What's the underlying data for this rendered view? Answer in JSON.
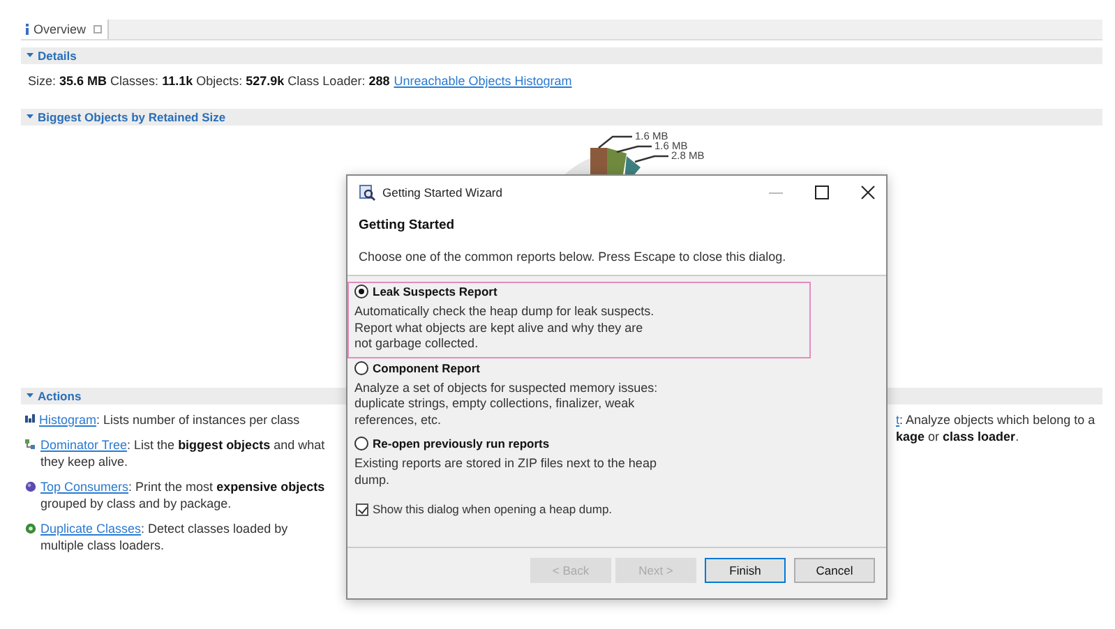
{
  "tab": {
    "label": "Overview",
    "selected": true
  },
  "details": {
    "title": "Details",
    "expanded": true,
    "stats": [
      {
        "label": "Size:",
        "value": "35.6 MB"
      },
      {
        "label": "Classes:",
        "value": "11.1k"
      },
      {
        "label": "Objects:",
        "value": "527.9k"
      },
      {
        "label": "Class Loader:",
        "value": "288"
      }
    ],
    "link": "Unreachable Objects Histogram"
  },
  "biggest": {
    "title": "Biggest Objects by Retained Size",
    "expanded": true,
    "pie_labels": [
      "1.6 MB",
      "1.6 MB",
      "2.8 MB"
    ]
  },
  "actions": {
    "title": "Actions",
    "expanded": true,
    "items": [
      {
        "kind": "histogram",
        "link": "Histogram",
        "text": ": Lists number of instances per class"
      },
      {
        "kind": "tree",
        "link": "Dominator Tree",
        "text": ": List the **biggest objects** and what they keep alive."
      },
      {
        "kind": "sphere",
        "link": "Top Consumers",
        "text": ": Print the most **expensive objects** grouped by class and by package."
      },
      {
        "kind": "duplicate",
        "link": "Duplicate Classes",
        "text": ": Detect classes loaded by multiple class loaders."
      }
    ],
    "right_item": {
      "link": "t",
      "text": ": Analyze objects which belong to a",
      "text_2": "**kage** or **class loader**."
    }
  },
  "dialog": {
    "title": "Getting Started Wizard",
    "heading": "Getting Started",
    "description": "Choose one of the common reports below. Press Escape to close this dialog.",
    "options": [
      {
        "label": "Leak Suspects Report",
        "selected": true,
        "highlighted": true,
        "description": "Automatically check the heap dump for leak suspects. Report what objects are kept alive and why they are not garbage collected."
      },
      {
        "label": "Component Report",
        "selected": false,
        "highlighted": false,
        "description": "Analyze a set of objects for suspected memory issues: duplicate strings, empty collections, finalizer, weak references, etc."
      },
      {
        "label": "Re-open previously run reports",
        "selected": false,
        "highlighted": false,
        "description": "Existing reports are stored in ZIP files next to the heap dump."
      }
    ],
    "show_dialog": {
      "label": "Show this dialog when opening a heap dump.",
      "checked": true
    },
    "buttons": [
      {
        "label": "< Back",
        "disabled": true,
        "default": false
      },
      {
        "label": "Next >",
        "disabled": true,
        "default": false
      },
      {
        "label": "Finish",
        "disabled": false,
        "default": true
      },
      {
        "label": "Cancel",
        "disabled": false,
        "default": false
      }
    ]
  }
}
